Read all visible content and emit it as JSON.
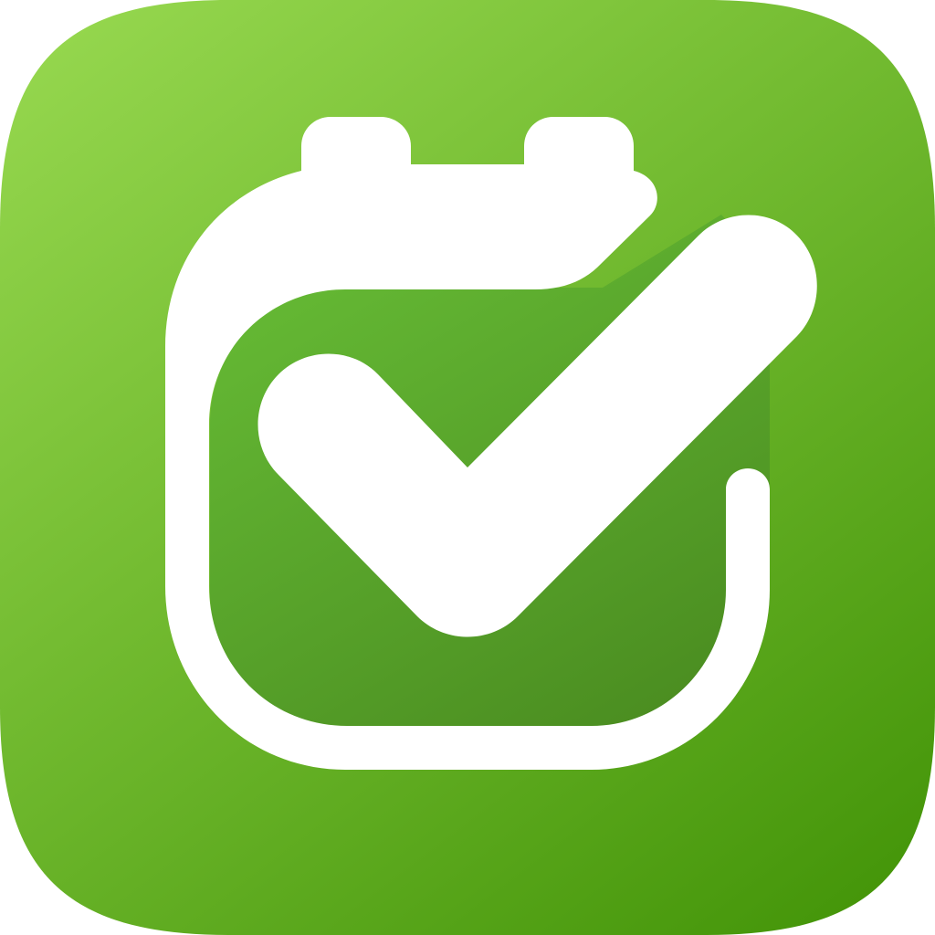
{
  "icon": {
    "name": "calendar-checkmark",
    "colors": {
      "background_light": "#94d64d",
      "background_dark": "#45960a",
      "inner_light": "#66bb35",
      "inner_dark": "#4a8c20",
      "foreground": "#ffffff"
    }
  }
}
